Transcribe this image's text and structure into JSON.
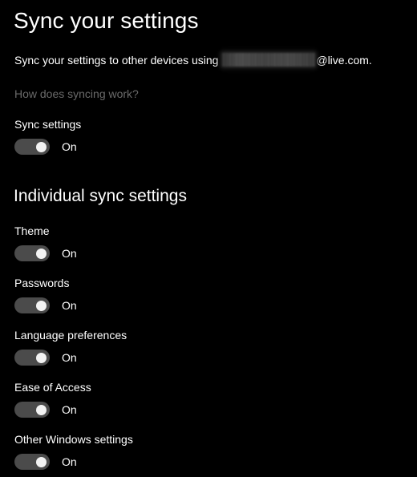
{
  "page": {
    "title": "Sync your settings",
    "background_color": "#000000",
    "text_color": "#ffffff"
  },
  "intro": {
    "prefix": "Sync your settings to other devices using ",
    "redacted_account": "",
    "suffix": "@live.com.",
    "redaction_color": "#333333"
  },
  "help_link": {
    "label": "How does syncing work?",
    "color": "#6a6a6a"
  },
  "master_setting": {
    "label": "Sync settings",
    "state": "On"
  },
  "individual_section": {
    "heading": "Individual sync settings",
    "items": [
      {
        "label": "Theme",
        "state": "On"
      },
      {
        "label": "Passwords",
        "state": "On"
      },
      {
        "label": "Language preferences",
        "state": "On"
      },
      {
        "label": "Ease of Access",
        "state": "On"
      },
      {
        "label": "Other Windows settings",
        "state": "On"
      }
    ]
  },
  "toggle_style": {
    "track_color": "#4b4b4b",
    "knob_color": "#f2f2f2"
  }
}
